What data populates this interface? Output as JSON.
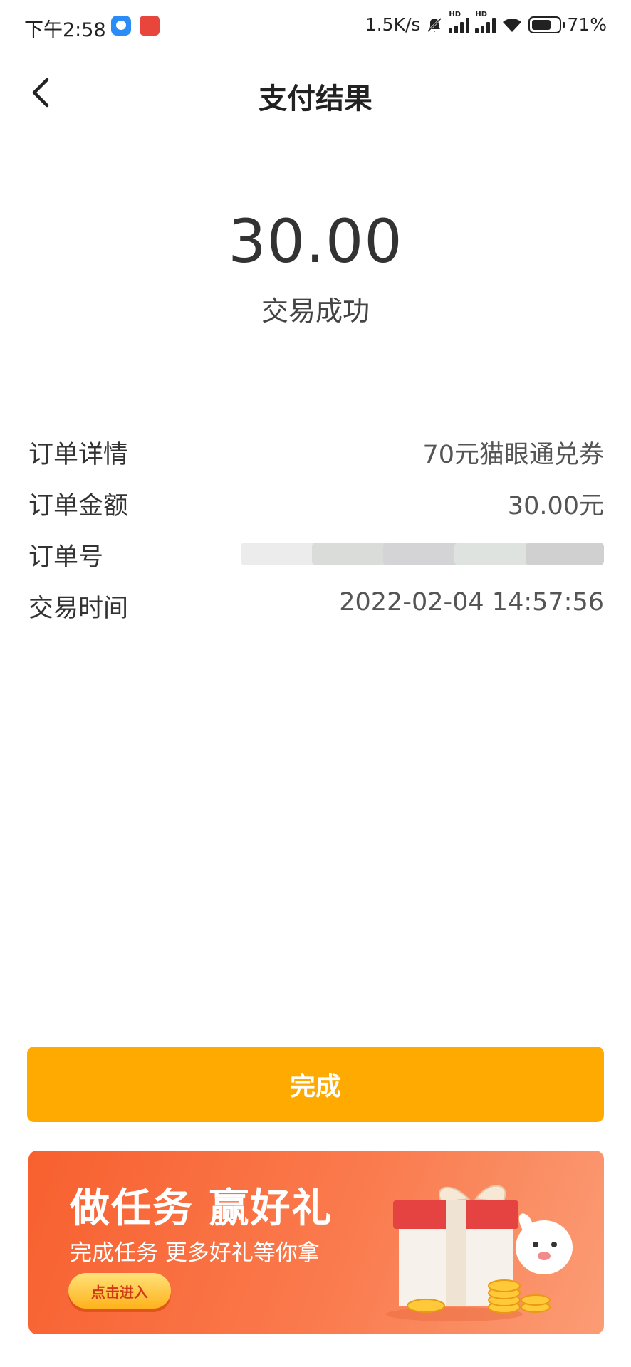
{
  "status_bar": {
    "time": "下午2:58",
    "speed": "1.5K/s",
    "hd1": "HD",
    "hd2": "HD",
    "battery": "71%"
  },
  "header": {
    "title": "支付结果",
    "back_icon": "chevron-left-icon"
  },
  "payment": {
    "amount": "30.00",
    "status": "交易成功"
  },
  "details": [
    {
      "label": "订单详情",
      "value": "70元猫眼通兑券"
    },
    {
      "label": "订单金额",
      "value": "30.00元"
    },
    {
      "label": "订单号",
      "value": ""
    },
    {
      "label": "交易时间",
      "value": "2022-02-04 14:57:56"
    }
  ],
  "actions": {
    "done_label": "完成",
    "accent_color": "#ffaa00"
  },
  "banner": {
    "title": "做任务 赢好礼",
    "subtitle": "完成任务 更多好礼等你拿",
    "button_label": "点击进入"
  }
}
